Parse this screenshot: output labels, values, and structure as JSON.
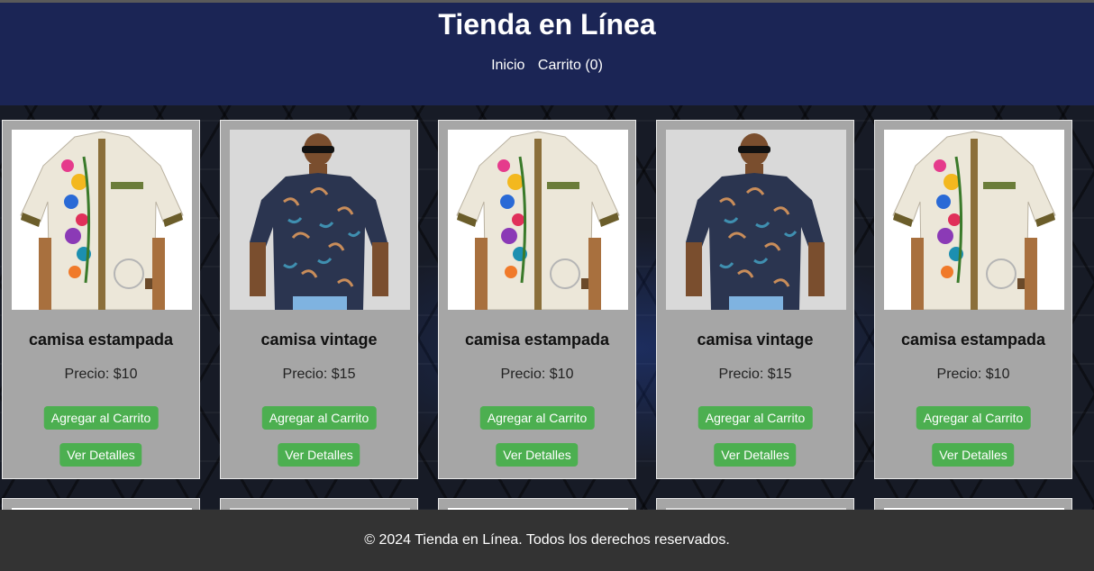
{
  "header": {
    "title": "Tienda en Línea",
    "nav": [
      {
        "label": "Inicio"
      },
      {
        "label": "Carrito (0)"
      }
    ]
  },
  "products": [
    {
      "name": "camisa estampada",
      "price": "Precio: $10",
      "add_label": "Agregar al Carrito",
      "details_label": "Ver Detalles",
      "image": "shirt-embroidered-white"
    },
    {
      "name": "camisa vintage",
      "price": "Precio: $15",
      "add_label": "Agregar al Carrito",
      "details_label": "Ver Detalles",
      "image": "shirt-navy-print-model"
    },
    {
      "name": "camisa estampada",
      "price": "Precio: $10",
      "add_label": "Agregar al Carrito",
      "details_label": "Ver Detalles",
      "image": "shirt-embroidered-white"
    },
    {
      "name": "camisa vintage",
      "price": "Precio: $15",
      "add_label": "Agregar al Carrito",
      "details_label": "Ver Detalles",
      "image": "shirt-navy-print-model"
    },
    {
      "name": "camisa estampada",
      "price": "Precio: $10",
      "add_label": "Agregar al Carrito",
      "details_label": "Ver Detalles",
      "image": "shirt-embroidered-white"
    }
  ],
  "footer": {
    "text": "© 2024 Tienda en Línea. Todos los derechos reservados."
  },
  "colors": {
    "header_bg": "#1b2555",
    "card_bg": "#a6a6a6",
    "button": "#4caf50",
    "footer_bg": "#333333"
  }
}
